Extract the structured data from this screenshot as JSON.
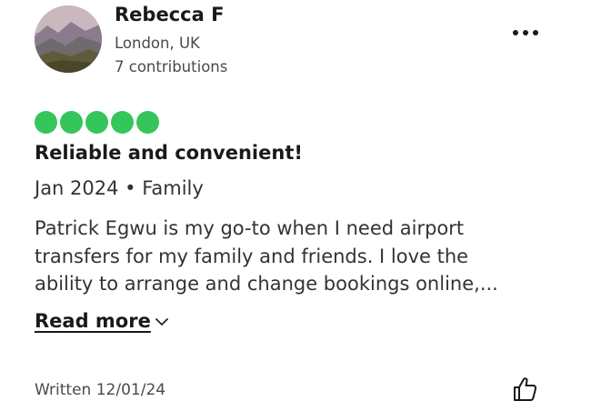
{
  "reviewer": {
    "name": "Rebecca F",
    "location": "London, UK",
    "contributions": "7 contributions"
  },
  "more_icon": "more-horizontal-icon",
  "rating": {
    "value": 5,
    "max": 5,
    "color": "#34c65a"
  },
  "review": {
    "title": "Reliable and convenient!",
    "meta": "Jan 2024 • Family",
    "body_lines": [
      "Patrick Egwu is my go-to when I need airport",
      "transfers for my family and friends.  I love the",
      "ability to arrange and change bookings online,..."
    ],
    "read_more": "Read more"
  },
  "footer": {
    "written": "Written 12/01/24",
    "helpful_icon": "thumbs-up-icon"
  }
}
